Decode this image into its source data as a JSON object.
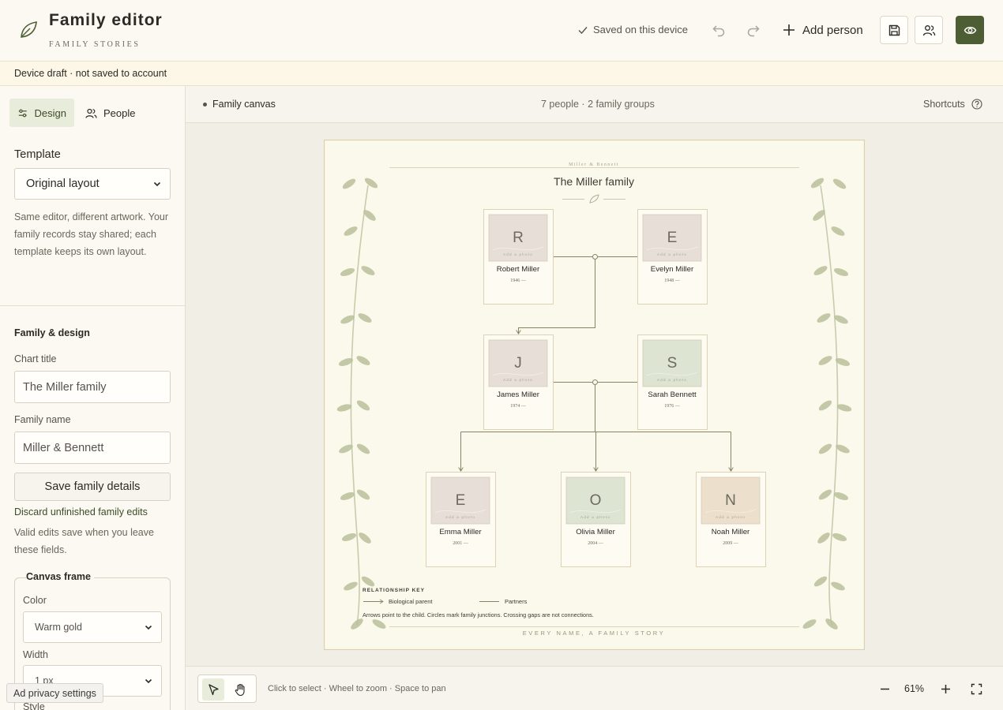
{
  "header": {
    "title": "Family editor",
    "subtitle": "FAMILY STORIES",
    "save_status": "Saved on this device",
    "add_person_label": "Add person"
  },
  "banner": {
    "text": "Device draft · not saved to account"
  },
  "sidebar": {
    "tabs": [
      {
        "label": "Design",
        "icon": "sliders-icon",
        "active": true
      },
      {
        "label": "People",
        "icon": "users-icon",
        "active": false
      }
    ],
    "template": {
      "label": "Template",
      "value": "Original layout",
      "help": "Same editor, different artwork. Your family records stay shared; each template keeps its own layout."
    },
    "family_design": {
      "title": "Family & design",
      "chart_title_label": "Chart title",
      "chart_title_value": "The Miller family",
      "family_name_label": "Family name",
      "family_name_value": "Miller & Bennett",
      "save_label": "Save family details",
      "discard_label": "Discard unfinished family edits",
      "note": "Valid edits save when you leave these fields."
    },
    "canvas_frame": {
      "title": "Canvas frame",
      "color_label": "Color",
      "color_value": "Warm gold",
      "width_label": "Width",
      "width_value": "1 px",
      "style_label": "Style"
    },
    "ad_privacy": "Ad privacy settings"
  },
  "canvas_bar": {
    "label": "Family canvas",
    "stats": "7 people · 2 family groups",
    "shortcuts": "Shortcuts"
  },
  "chart": {
    "header": "Miller & Bennett",
    "title": "The Miller family",
    "photo_hint": "Add a photo",
    "people": [
      {
        "id": "robert",
        "initial": "R",
        "name": "Robert Miller",
        "years": "1946 —",
        "tint": "#e7dfd7"
      },
      {
        "id": "evelyn",
        "initial": "E",
        "name": "Evelyn Miller",
        "years": "1948 —",
        "tint": "#e7dfd7"
      },
      {
        "id": "james",
        "initial": "J",
        "name": "James Miller",
        "years": "1974 —",
        "tint": "#e7dfd7"
      },
      {
        "id": "sarah",
        "initial": "S",
        "name": "Sarah Bennett",
        "years": "1976 —",
        "tint": "#dde4d2"
      },
      {
        "id": "emma",
        "initial": "E",
        "name": "Emma Miller",
        "years": "2001 —",
        "tint": "#e7dfd7"
      },
      {
        "id": "olivia",
        "initial": "O",
        "name": "Olivia Miller",
        "years": "2004 —",
        "tint": "#dde4d2"
      },
      {
        "id": "noah",
        "initial": "N",
        "name": "Noah Miller",
        "years": "2009 —",
        "tint": "#ecdfcc"
      }
    ],
    "key": {
      "title": "RELATIONSHIP KEY",
      "bio": "Biological parent",
      "partners": "Partners",
      "note": "Arrows point to the child. Circles mark family junctions. Crossing gaps are not connections."
    },
    "footer": "EVERY NAME, A FAMILY STORY"
  },
  "bottom_bar": {
    "hint": "Click to select · Wheel to zoom · Space to pan",
    "zoom": "61%"
  },
  "colors": {
    "accent": "#4e5e34",
    "line": "#8a8467",
    "leaf": "#b8bf9a",
    "paper": "#fbf8ec"
  }
}
